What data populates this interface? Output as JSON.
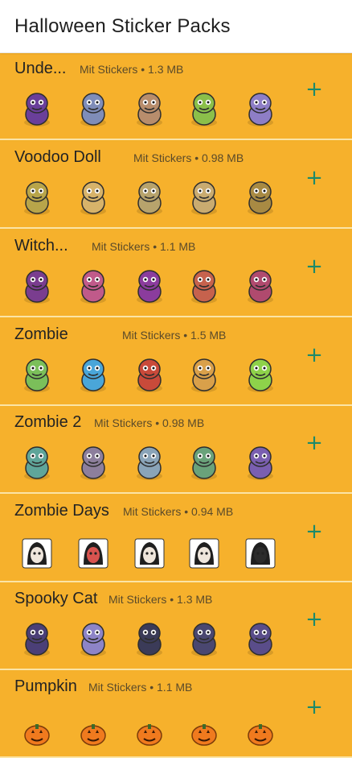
{
  "header": {
    "title": "Halloween Sticker Packs"
  },
  "packs": [
    {
      "name": "Unde...",
      "meta": "Mit Stickers • 1.3 MB",
      "add_label": "+",
      "stickers": [
        "demon-sticker",
        "gargoyle-sticker",
        "chief-sticker",
        "witch-potion-sticker",
        "purple-demon-sticker"
      ],
      "colors": [
        "#6a3f9a",
        "#7f8db8",
        "#b88d6c",
        "#8bbf4a",
        "#8e7ec6"
      ]
    },
    {
      "name": "Voodoo Doll",
      "meta": "Mit Stickers • 0.98 MB",
      "add_label": "+",
      "stickers": [
        "voodoo-sun-sticker",
        "voodoo-hearts-sticker",
        "voodoo-angry-sticker",
        "voodoo-pins-sticker",
        "voodoo-sitting-sticker"
      ],
      "colors": [
        "#b8a54a",
        "#d7b36a",
        "#b7a36c",
        "#c9ab70",
        "#a88a43"
      ]
    },
    {
      "name": "Witch...",
      "meta": "Mit Stickers • 1.1 MB",
      "add_label": "+",
      "stickers": [
        "witch-sticker",
        "witch-heart-sticker",
        "witch-hat-sticker",
        "witch-orange-sticker",
        "witch-red-sticker"
      ],
      "colors": [
        "#7a3d8f",
        "#c05a8a",
        "#8b3c9d",
        "#c6624d",
        "#b04a6e"
      ]
    },
    {
      "name": "Zombie",
      "meta": "Mit Stickers • 1.5 MB",
      "add_label": "+",
      "stickers": [
        "zombie-lab-sticker",
        "zombie-pool-sticker",
        "zombie-sale-sticker",
        "zombie-sign-sticker",
        "zombie-grad-sticker"
      ],
      "colors": [
        "#7bbf5a",
        "#4aa6d9",
        "#c94a3a",
        "#d9a04a",
        "#8ed24a"
      ]
    },
    {
      "name": "Zombie 2",
      "meta": "Mit Stickers • 0.98 MB",
      "add_label": "+",
      "stickers": [
        "zombie-green-sticker",
        "zombie-face-sticker",
        "zombie-grey-sticker",
        "zombie-scream-sticker",
        "zombie-purple-sticker"
      ],
      "colors": [
        "#5fa59a",
        "#8d7f9c",
        "#8aa4b8",
        "#6aa27a",
        "#7a5fb0"
      ]
    },
    {
      "name": "Zombie Days",
      "meta": "Mit Stickers • 0.94 MB",
      "add_label": "+",
      "stickers": [
        "ghost-girl-sticker",
        "ghost-love-sticker",
        "ghost-hair-sticker",
        "ghost-hello-sticker",
        "ghost-dark-sticker"
      ],
      "colors": [
        "#efe6dc",
        "#d9534f",
        "#efe6dc",
        "#efe6dc",
        "#2b2b2b"
      ]
    },
    {
      "name": "Spooky Cat",
      "meta": "Mit Stickers • 1.3 MB",
      "add_label": "+",
      "stickers": [
        "cat-witch-sticker",
        "cat-ghost-sticker",
        "cat-pumpkin-sticker",
        "cat-black-sticker",
        "cat-hat-sticker"
      ],
      "colors": [
        "#4b3f77",
        "#8d84c7",
        "#3b3b58",
        "#4a4770",
        "#5a4d8a"
      ]
    },
    {
      "name": "Pumpkin",
      "meta": "Mit Stickers • 1.1 MB",
      "add_label": "+",
      "stickers": [
        "pumpkin-1-sticker",
        "pumpkin-2-sticker",
        "pumpkin-3-sticker",
        "pumpkin-4-sticker",
        "pumpkin-5-sticker"
      ],
      "colors": [
        "#f07a1e",
        "#f07a1e",
        "#f07a1e",
        "#f07a1e",
        "#f07a1e"
      ]
    }
  ]
}
